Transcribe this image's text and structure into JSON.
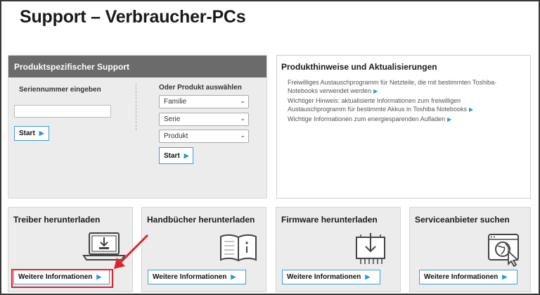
{
  "page_title": "Support – Verbraucher-PCs",
  "support": {
    "header": "Produktspezifischer Support",
    "serial_label": "Seriennummer eingeben",
    "serial_value": "",
    "start_label": "Start",
    "or_label": "Oder Produkt auswählen",
    "selects": [
      "Familie",
      "Serie",
      "Produkt"
    ],
    "start2_label": "Start"
  },
  "notices": {
    "title": "Produkthinweise und Aktualisierungen",
    "items": [
      "Freiwilliges Austauschprogramm für Netzteile, die mit bestimmten Toshiba-Notebooks verwendet werden",
      "Wichtiger Hinweis: aktualisierte Informationen zum freiwilligen Austauschprogramm für bestimmte Akkus in Toshiba Notebooks",
      "Wichtige Informationen zum energiesparenden Aufladen"
    ]
  },
  "cards": [
    {
      "title": "Treiber herunterladen",
      "button": "Weitere Informationen",
      "icon": "laptop-download-icon"
    },
    {
      "title": "Handbücher herunterladen",
      "button": "Weitere Informationen",
      "icon": "manual-book-icon"
    },
    {
      "title": "Firmware herunterladen",
      "button": "Weitere Informationen",
      "icon": "chip-download-icon"
    },
    {
      "title": "Serviceanbieter suchen",
      "button": "Weitere Informationen",
      "icon": "globe-cursor-icon"
    }
  ],
  "colors": {
    "accent": "#2f95d4",
    "panel_header": "#6b6b6b",
    "highlight": "#e2222b"
  }
}
